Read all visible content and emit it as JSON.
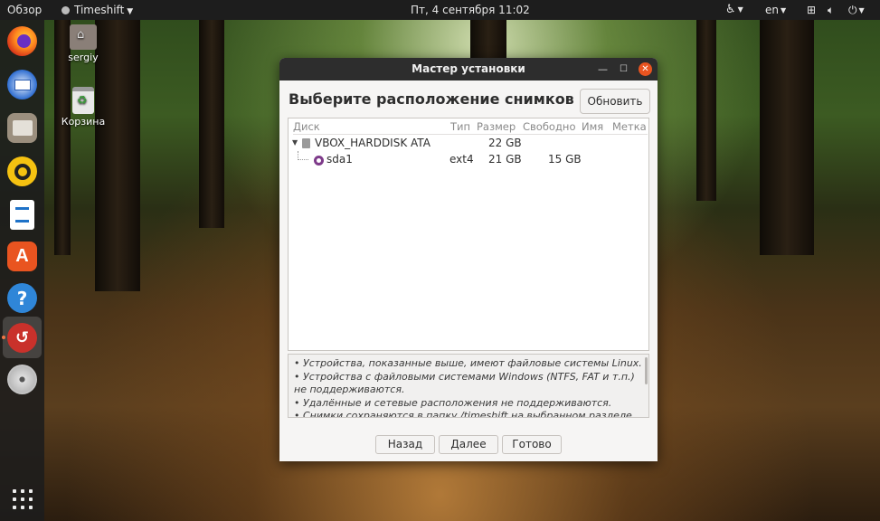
{
  "topbar": {
    "overview": "Обзор",
    "app_name": "Timeshift",
    "clock": "Пт, 4 сентября  11:02",
    "language": "en"
  },
  "desktop": {
    "home_label": "sergiy",
    "trash_label": "Корзина"
  },
  "window": {
    "title": "Мастер установки",
    "heading": "Выберите расположение снимков",
    "refresh_label": "Обновить",
    "table": {
      "headers": {
        "disk": "Диск",
        "type": "Тип",
        "size": "Размер",
        "free": "Свободно",
        "name": "Имя",
        "label": "Метка"
      },
      "disk": {
        "name": "VBOX_HARDDISK ATA",
        "size": "22 GB"
      },
      "partition": {
        "name": "sda1",
        "type": "ext4",
        "size": "21 GB",
        "free": "15 GB"
      }
    },
    "notes": [
      "• Устройства, показанные выше, имеют файловые системы Linux.",
      "• Устройства с файловыми системами Windows (NTFS, FAT и т.п.) не поддерживаются.",
      "• Удалённые и сетевые расположения не поддерживаются.",
      "• Снимки сохраняются в папку /timeshift на выбранном разделе. Другие"
    ],
    "buttons": {
      "back": "Назад",
      "next": "Далее",
      "done": "Готово"
    }
  }
}
